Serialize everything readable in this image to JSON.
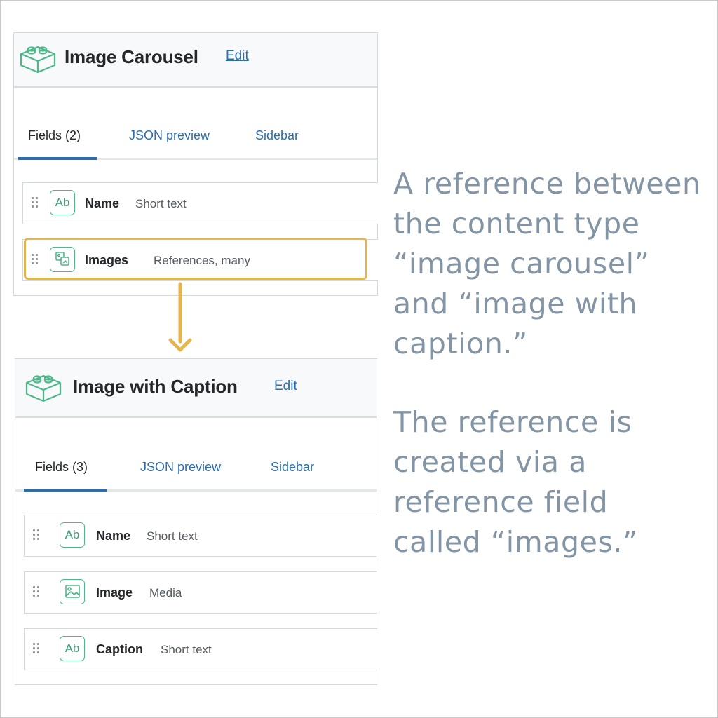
{
  "panels": [
    {
      "title": "Image Carousel",
      "edit_label": "Edit",
      "tabs": [
        "Fields (2)",
        "JSON preview",
        "Sidebar"
      ],
      "fields": [
        {
          "icon": "Ab",
          "name": "Name",
          "type": "Short text"
        },
        {
          "icon": "ref",
          "name": "Images",
          "type": "References, many"
        }
      ]
    },
    {
      "title": "Image with Caption",
      "edit_label": "Edit",
      "tabs": [
        "Fields (3)",
        "JSON preview",
        "Sidebar"
      ],
      "fields": [
        {
          "icon": "Ab",
          "name": "Name",
          "type": "Short text"
        },
        {
          "icon": "image",
          "name": "Image",
          "type": "Media"
        },
        {
          "icon": "Ab",
          "name": "Caption",
          "type": "Short text"
        }
      ]
    }
  ],
  "annotation": {
    "paragraph1": [
      "A reference between",
      "the content type",
      "“image carousel”",
      "and “image with",
      "caption.”"
    ],
    "paragraph2": [
      "The reference is",
      "created via a",
      "reference field",
      "called “images.”"
    ]
  },
  "colors": {
    "accent": "#2a6db0",
    "icon_green": "#4fb88a",
    "highlight": "#e4b54e",
    "annotation_text": "#8394a4"
  }
}
